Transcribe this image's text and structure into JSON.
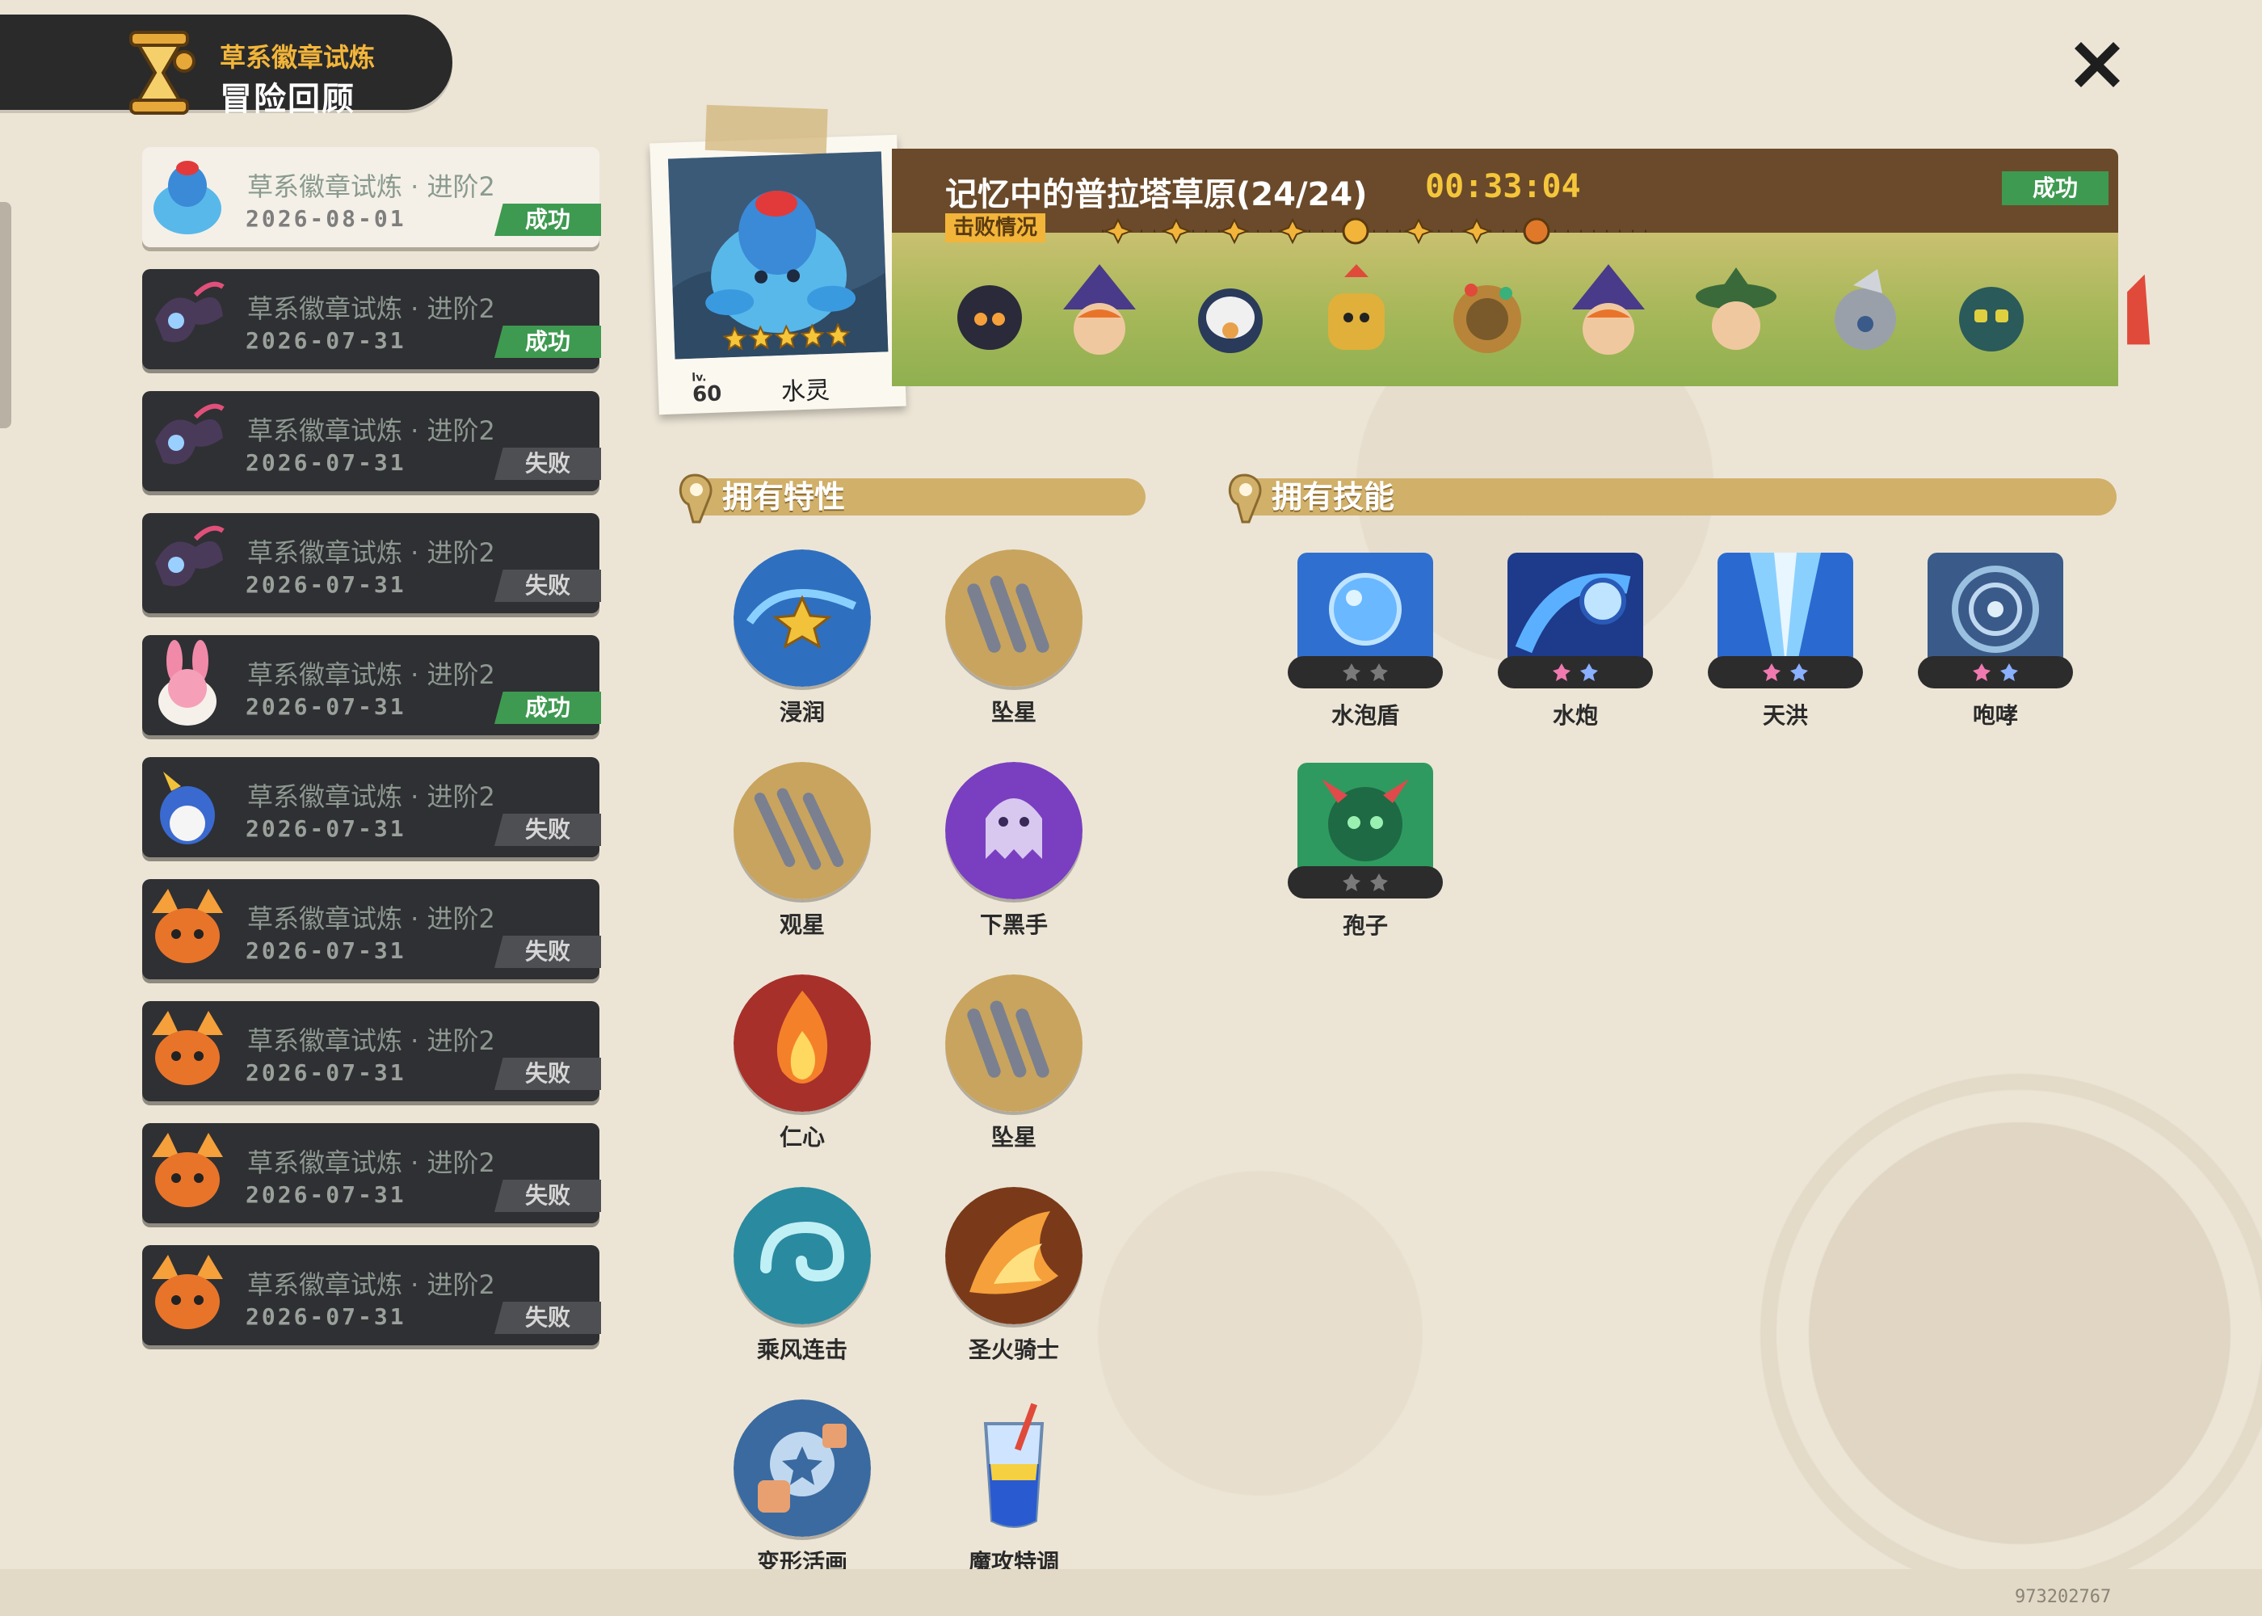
{
  "header": {
    "subtitle": "草系徽章试炼",
    "title": "冒险回顾"
  },
  "records": [
    {
      "title": "草系徽章试炼 · 进阶2",
      "date": "2026-08-01",
      "result": "成功",
      "status": "success",
      "avatar": "water-spirit-avatar-icon"
    },
    {
      "title": "草系徽章试炼 · 进阶2",
      "date": "2026-07-31",
      "result": "成功",
      "status": "success",
      "avatar": "dark-moth-avatar-icon"
    },
    {
      "title": "草系徽章试炼 · 进阶2",
      "date": "2026-07-31",
      "result": "失败",
      "status": "fail",
      "avatar": "dark-moth-avatar-icon"
    },
    {
      "title": "草系徽章试炼 · 进阶2",
      "date": "2026-07-31",
      "result": "失败",
      "status": "fail",
      "avatar": "dark-moth-avatar-icon"
    },
    {
      "title": "草系徽章试炼 · 进阶2",
      "date": "2026-07-31",
      "result": "成功",
      "status": "success",
      "avatar": "pink-rabbit-avatar-icon"
    },
    {
      "title": "草系徽章试炼 · 进阶2",
      "date": "2026-07-31",
      "result": "失败",
      "status": "fail",
      "avatar": "blue-penguin-avatar-icon"
    },
    {
      "title": "草系徽章试炼 · 进阶2",
      "date": "2026-07-31",
      "result": "失败",
      "status": "fail",
      "avatar": "fire-fox-avatar-icon"
    },
    {
      "title": "草系徽章试炼 · 进阶2",
      "date": "2026-07-31",
      "result": "失败",
      "status": "fail",
      "avatar": "fire-fox-avatar-icon"
    },
    {
      "title": "草系徽章试炼 · 进阶2",
      "date": "2026-07-31",
      "result": "失败",
      "status": "fail",
      "avatar": "fire-fox-avatar-icon"
    },
    {
      "title": "草系徽章试炼 · 进阶2",
      "date": "2026-07-31",
      "result": "失败",
      "status": "fail",
      "avatar": "fire-fox-avatar-icon"
    }
  ],
  "creature": {
    "level_prefix": "lv.",
    "level": "60",
    "name": "水灵",
    "stars": 5
  },
  "battle": {
    "location": "记忆中的普拉塔草原(24/24)",
    "time": "00:33:04",
    "defeat_label": "击败情况",
    "result": "成功"
  },
  "sections": {
    "traits_title": "拥有特性",
    "skills_title": "拥有技能"
  },
  "traits": [
    {
      "name": "浸润",
      "icon": "water-star-icon",
      "color": "#2f6fbf"
    },
    {
      "name": "坠星",
      "icon": "falling-star-icon",
      "color": "#c8a45e"
    },
    {
      "name": "观星",
      "icon": "stargazing-icon",
      "color": "#c8a45e"
    },
    {
      "name": "下黑手",
      "icon": "ghost-icon",
      "color": "#7a3fc0"
    },
    {
      "name": "仁心",
      "icon": "flame-icon",
      "color": "#c0402a"
    },
    {
      "name": "坠星",
      "icon": "falling-star-icon",
      "color": "#c8a45e"
    },
    {
      "name": "乘风连击",
      "icon": "wind-swirl-icon",
      "color": "#3a9ab0"
    },
    {
      "name": "圣火骑士",
      "icon": "holy-fire-icon",
      "color": "#d86a2a"
    },
    {
      "name": "变形活画",
      "icon": "morph-painting-icon",
      "color": "#3a6aa0"
    },
    {
      "name": "魔攻特调",
      "icon": "potion-drink-icon",
      "color": "#e8e4d8"
    }
  ],
  "skills": [
    {
      "name": "水泡盾",
      "icon": "bubble-shield-icon",
      "color": "#2f6fcf"
    },
    {
      "name": "水炮",
      "icon": "water-cannon-icon",
      "color": "#2a5ab8"
    },
    {
      "name": "天洪",
      "icon": "sky-flood-icon",
      "color": "#2a6ad0"
    },
    {
      "name": "咆哮",
      "icon": "roar-icon",
      "color": "#3a5a8a"
    },
    {
      "name": "孢子",
      "icon": "spore-icon",
      "color": "#2e9a60"
    }
  ],
  "footer": {
    "uid": "973202767"
  }
}
